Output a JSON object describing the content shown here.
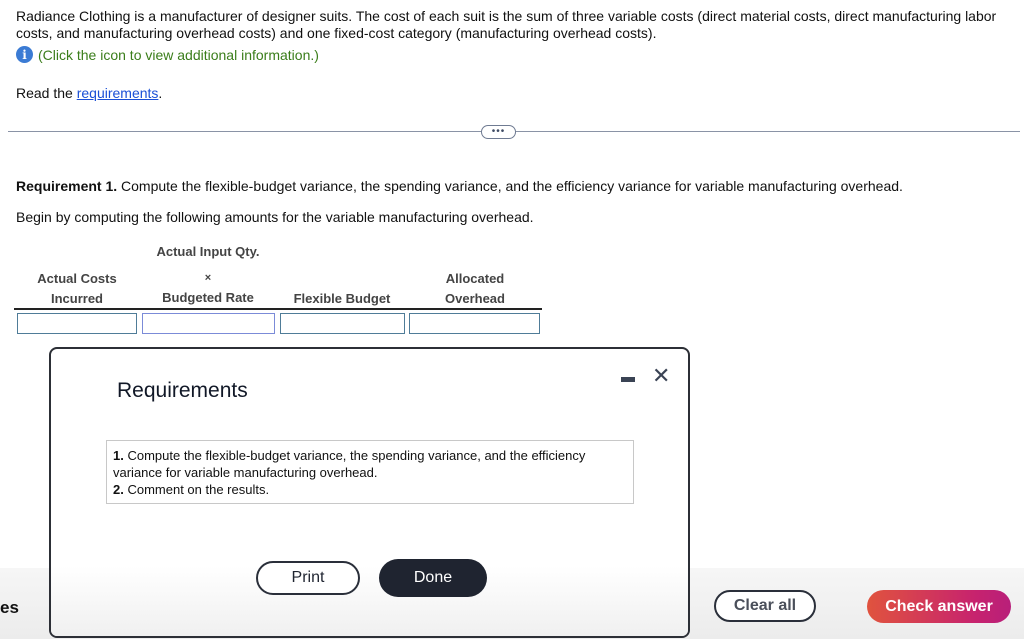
{
  "intro": {
    "text": "Radiance Clothing is a manufacturer of designer suits. The cost of each suit is the sum of three variable costs (direct material costs, direct manufacturing labor costs, and manufacturing overhead costs) and one fixed-cost category (manufacturing overhead costs).",
    "info_icon": "info-icon",
    "info_text": "(Click the icon to view additional information.)",
    "read_prefix": "Read the ",
    "read_link": "requirements",
    "read_suffix": "."
  },
  "expand_button": {
    "label": "•••"
  },
  "requirement1": {
    "label": "Requirement 1.",
    "text": " Compute the flexible-budget variance, the spending variance, and the efficiency variance for variable manufacturing overhead.",
    "begin": "Begin by computing the following amounts for the variable manufacturing overhead."
  },
  "table": {
    "headers": [
      {
        "line1": "Actual Costs",
        "line2": "Incurred"
      },
      {
        "line0": "Actual Input Qty.",
        "line1": "×",
        "line2": "Budgeted Rate"
      },
      {
        "line1": "",
        "line2": "Flexible Budget"
      },
      {
        "line1": "Allocated",
        "line2": "Overhead"
      }
    ],
    "inputs": [
      "",
      "",
      "",
      ""
    ]
  },
  "modal": {
    "title": "Requirements",
    "minimize_icon": "minimize-icon",
    "close_icon": "close-icon",
    "items": [
      {
        "num": "1.",
        "text": " Compute the flexible-budget variance, the spending variance, and the efficiency variance for variable manufacturing overhead."
      },
      {
        "num": "2.",
        "text": " Comment on the results."
      }
    ],
    "print_label": "Print",
    "done_label": "Done"
  },
  "footer": {
    "side_text": "es",
    "clear_label": "Clear all",
    "check_label": "Check answer"
  },
  "colors": {
    "accent_start": "#e0533e",
    "accent_end": "#b81f7a",
    "info_blue": "#3b7bd4",
    "info_green": "#3a7d1a",
    "link": "#1a4fd6",
    "dark_button": "#1f2430"
  }
}
